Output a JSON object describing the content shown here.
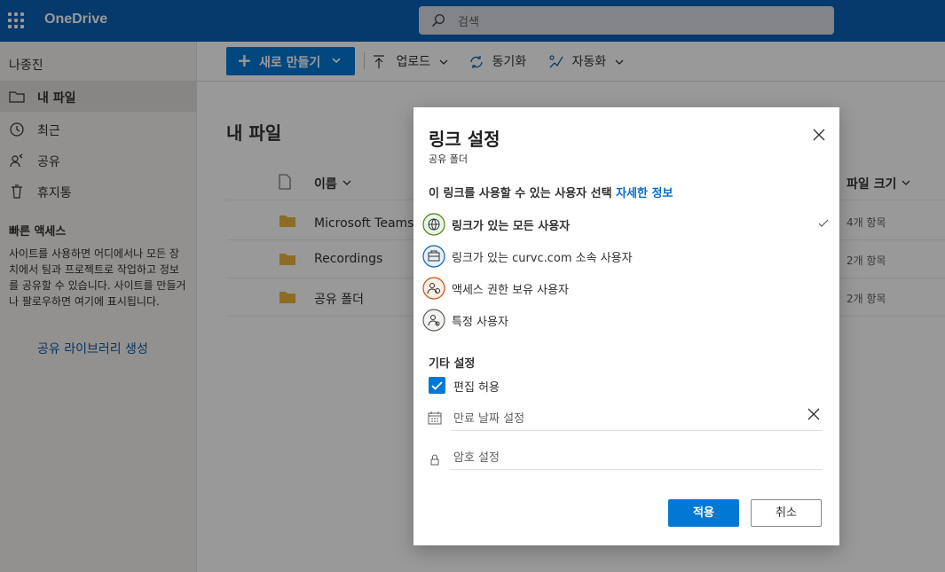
{
  "app": {
    "brand": "OneDrive"
  },
  "search": {
    "placeholder": "검색"
  },
  "sidebar": {
    "user": "나종진",
    "items": [
      {
        "label": "내 파일",
        "icon": "folder-icon",
        "active": true
      },
      {
        "label": "최근",
        "icon": "history-icon",
        "active": false
      },
      {
        "label": "공유",
        "icon": "share-icon",
        "active": false
      },
      {
        "label": "휴지통",
        "icon": "recycle-bin-icon",
        "active": false
      }
    ],
    "quick_access": {
      "title": "빠른 액세스",
      "text": "사이트를 사용하면 어디에서나 모든 장치에서 팀과 프로젝트로 작업하고 정보를 공유할 수 있습니다. 사이트를 만들거나 팔로우하면 여기에 표시됩니다.",
      "link": "공유 라이브러리 생성"
    }
  },
  "commands": {
    "new": "새로 만들기",
    "upload": "업로드",
    "sync": "동기화",
    "automate": "자동화"
  },
  "main": {
    "title": "내 파일",
    "columns": {
      "name": "이름",
      "size": "파일 크기"
    },
    "rows": [
      {
        "name": "Microsoft Teams 채",
        "size": "4개 항목"
      },
      {
        "name": "Recordings",
        "size": "2개 항목"
      },
      {
        "name": "공유 폴더",
        "size": "2개 항목"
      }
    ]
  },
  "dialog": {
    "title": "링크 설정",
    "subtitle": "공유 폴더",
    "question": "이 링크를 사용할 수 있는 사용자 선택",
    "learn_more": "자세한 정보",
    "options": [
      {
        "label": "링크가 있는 모든 사용자",
        "icon": "globe-icon",
        "selected": true
      },
      {
        "label": "링크가 있는 curvc.com 소속 사용자",
        "icon": "organization-icon",
        "selected": false
      },
      {
        "label": "액세스 권한 보유 사용자",
        "icon": "people-icon",
        "selected": false
      },
      {
        "label": "특정 사용자",
        "icon": "specific-people-icon",
        "selected": false
      }
    ],
    "other_settings": "기타 설정",
    "allow_edit": {
      "label": "편집 허용",
      "checked": true
    },
    "expiry": {
      "placeholder": "만료 날짜 설정"
    },
    "password": {
      "placeholder": "암호 설정"
    },
    "apply": "적용",
    "cancel": "취소"
  },
  "colors": {
    "topbar": "#0b60b5",
    "accent": "#0078d4",
    "link": "#0b6cc4"
  }
}
